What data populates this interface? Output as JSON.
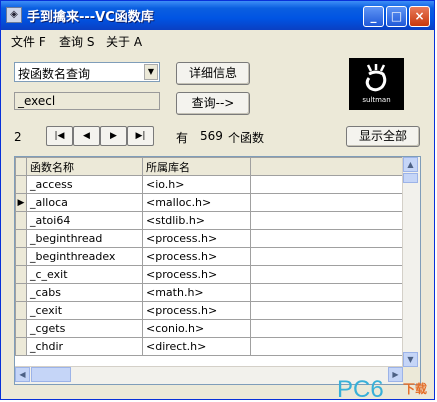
{
  "window": {
    "title": "手到擒来---VC函数库",
    "minimize": "_",
    "maximize": "□",
    "close": "×"
  },
  "menu": [
    {
      "label": "文件 F"
    },
    {
      "label": "查询 S"
    },
    {
      "label": "关于 A"
    }
  ],
  "search": {
    "mode_selected": "按函数名查询",
    "query_value": "_execl",
    "details_button": "详细信息",
    "query_button": "查询-->",
    "show_all_button": "显示全部"
  },
  "logo": {
    "text": "sultman"
  },
  "nav": {
    "page": "2",
    "first": "|◀",
    "prev": "◀",
    "next": "▶",
    "last": "▶|",
    "count_prefix": "有",
    "count": "569",
    "count_suffix": "个函数"
  },
  "table": {
    "columns": [
      "函数名称",
      "所属库名"
    ],
    "current_row_marker": "▶",
    "rows": [
      {
        "name": "_access",
        "lib": "<io.h>"
      },
      {
        "name": "_alloca",
        "lib": "<malloc.h>"
      },
      {
        "name": "_atoi64",
        "lib": "<stdlib.h>"
      },
      {
        "name": "_beginthread",
        "lib": "<process.h>"
      },
      {
        "name": "_beginthreadex",
        "lib": "<process.h>"
      },
      {
        "name": "_c_exit",
        "lib": "<process.h>"
      },
      {
        "name": "_cabs",
        "lib": "<math.h>"
      },
      {
        "name": "_cexit",
        "lib": "<process.h>"
      },
      {
        "name": "_cgets",
        "lib": "<conio.h>"
      },
      {
        "name": "_chdir",
        "lib": "<direct.h>"
      }
    ],
    "current_row": 1
  },
  "scroll": {
    "up": "▲",
    "down": "▼",
    "left": "◀",
    "right": "▶"
  },
  "watermark": {
    "brand": "PC6",
    "suffix": "下载"
  }
}
